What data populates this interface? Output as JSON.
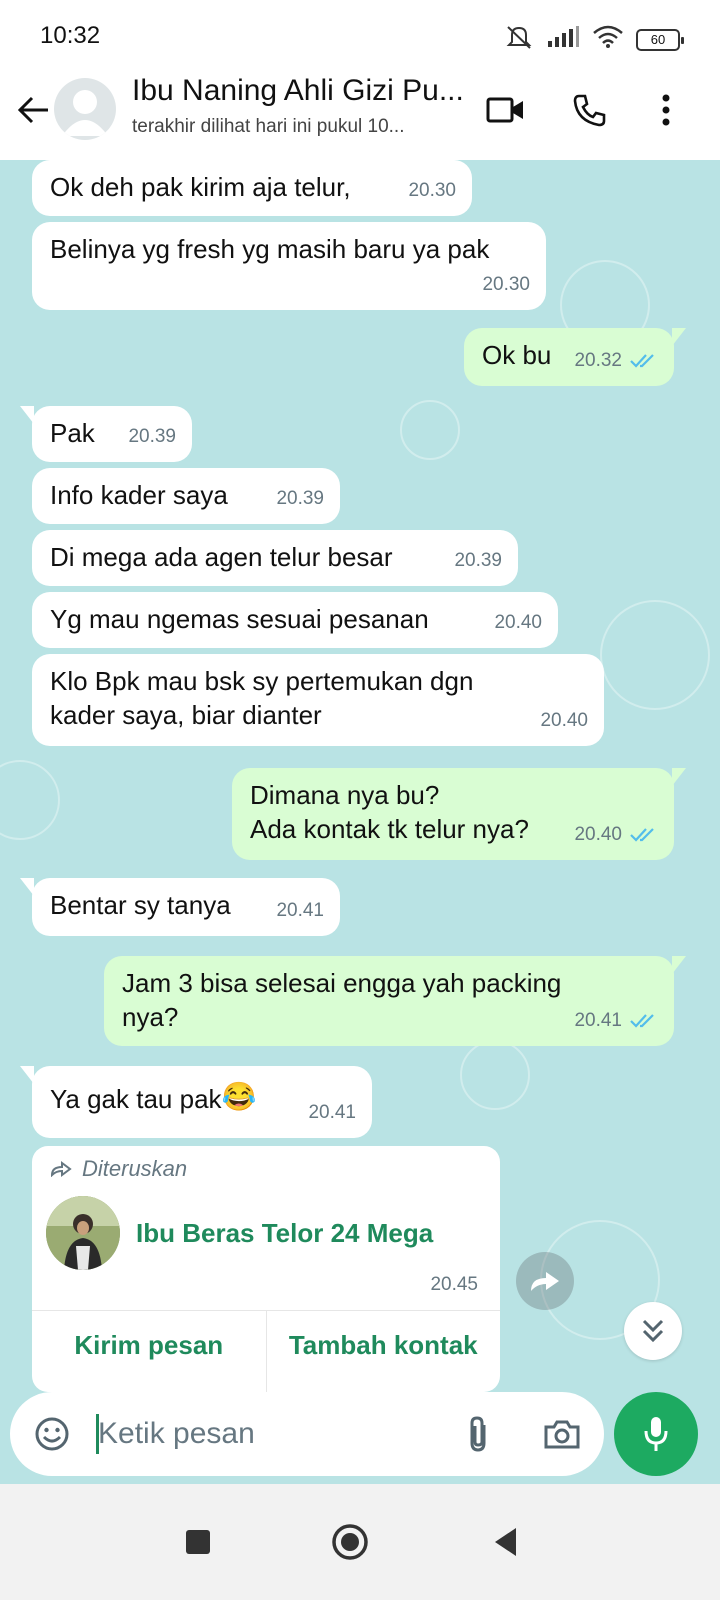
{
  "status_bar": {
    "time": "10:32",
    "battery": "60"
  },
  "header": {
    "contact_name": "Ibu Naning Ahli Gizi Pu...",
    "last_seen": "terakhir dilihat hari ini pukul 10...",
    "icons": [
      "back-arrow-icon",
      "video-call-icon",
      "phone-icon",
      "more-vert-icon"
    ]
  },
  "messages": [
    {
      "dir": "in",
      "text": "Ok deh pak kirim aja telur,",
      "time": "20.30"
    },
    {
      "dir": "in",
      "text": "Belinya yg fresh yg masih baru ya pak",
      "time": "20.30"
    },
    {
      "dir": "out",
      "text": "Ok bu",
      "time": "20.32",
      "status": "read"
    },
    {
      "dir": "in",
      "text": "Pak",
      "time": "20.39"
    },
    {
      "dir": "in",
      "text": "Info kader saya",
      "time": "20.39"
    },
    {
      "dir": "in",
      "text": "Di mega ada agen telur besar",
      "time": "20.39"
    },
    {
      "dir": "in",
      "text": "Yg mau ngemas sesuai pesanan",
      "time": "20.40"
    },
    {
      "dir": "in",
      "text_lines": [
        "Klo Bpk mau bsk sy pertemukan dgn",
        "kader saya, biar dianter"
      ],
      "time": "20.40"
    },
    {
      "dir": "out",
      "text_lines": [
        "Dimana nya bu?",
        "Ada kontak tk telur nya?"
      ],
      "time": "20.40",
      "status": "read"
    },
    {
      "dir": "in",
      "text": "Bentar sy tanya",
      "time": "20.41"
    },
    {
      "dir": "out",
      "text_lines": [
        "Jam 3 bisa selesai engga yah packing",
        "nya?"
      ],
      "time": "20.41",
      "status": "read"
    },
    {
      "dir": "in",
      "text": "Ya gak tau pak",
      "emoji": "😂",
      "time": "20.41"
    }
  ],
  "contact_card": {
    "forwarded_label": "Diteruskan",
    "name": "Ibu Beras Telor 24 Mega",
    "time": "20.45",
    "action_send": "Kirim pesan",
    "action_add": "Tambah kontak"
  },
  "input": {
    "placeholder": "Ketik pesan"
  },
  "colors": {
    "chat_bg": "#b9e3e4",
    "outgoing_bubble": "#d9fdd3",
    "incoming_bubble": "#ffffff",
    "accent_green": "#1daa61",
    "read_tick_blue": "#53bdeb"
  }
}
